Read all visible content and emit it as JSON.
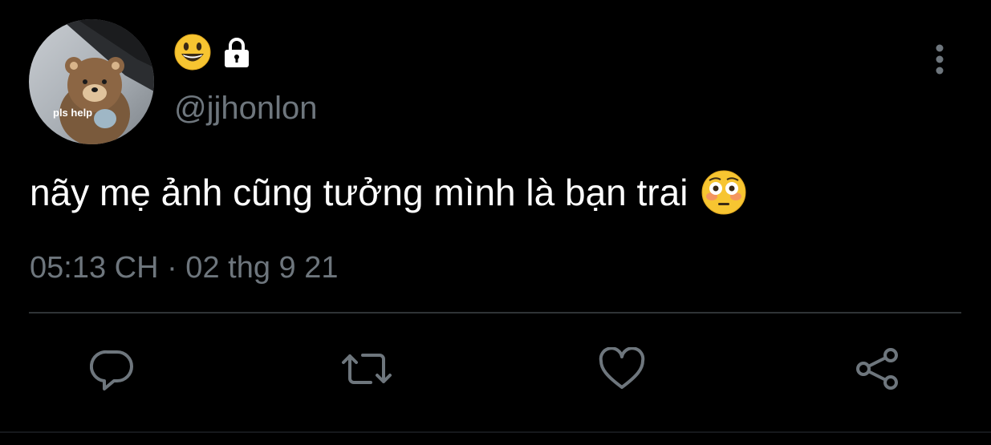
{
  "user": {
    "avatar_caption": "pls help",
    "display_name_icons": [
      "grinning-face-emoji",
      "lock-icon"
    ],
    "handle": "@jjhonlon"
  },
  "tweet": {
    "text": "nãy mẹ ảnh cũng tưởng mình là bạn trai",
    "emoji": "flushed-face-emoji",
    "timestamp": "05:13 CH · 02 thg 9 21"
  },
  "actions": [
    "reply-icon",
    "retweet-icon",
    "like-icon",
    "share-icon"
  ],
  "menu": {
    "icon": "more-vertical-icon"
  },
  "colors": {
    "background": "#000000",
    "text_primary": "#ffffff",
    "text_secondary": "#6e767d",
    "divider": "#2f3336",
    "action_icon": "#6e767d"
  }
}
